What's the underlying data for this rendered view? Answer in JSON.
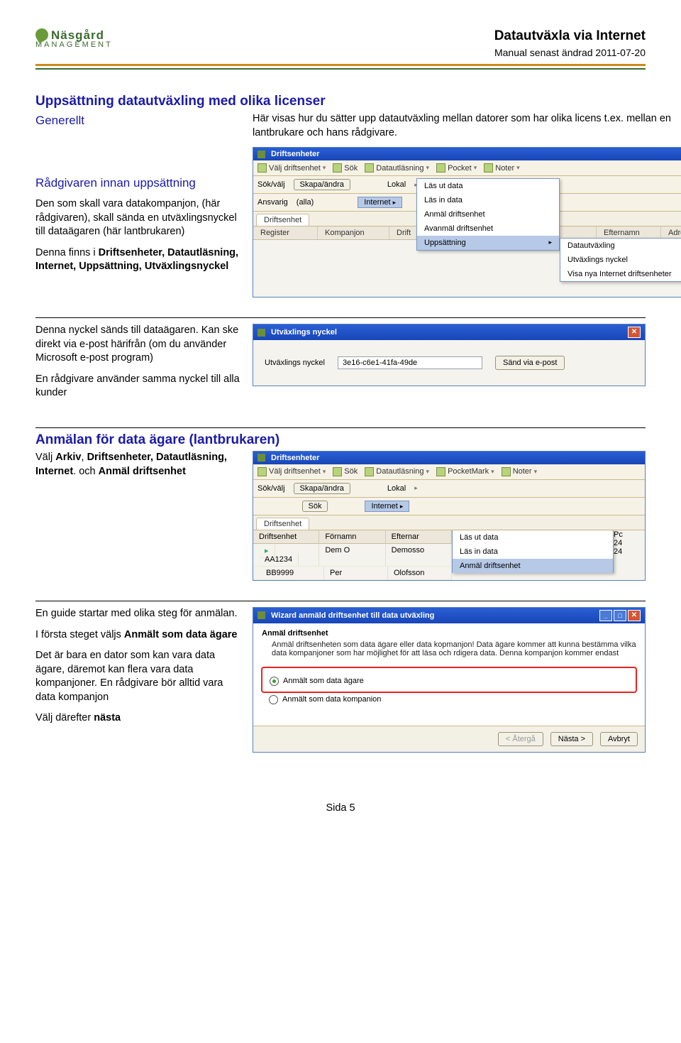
{
  "header": {
    "logo_top": "Näsgård",
    "logo_bottom": "MANAGEMENT",
    "title": "Datautväxla via Internet",
    "subtitle": "Manual senast ändrad 2011-07-20"
  },
  "section1": {
    "title": "Uppsättning datautväxling med olika licenser",
    "left_sub1": "Generellt",
    "right_p1": "Här visas hur du sätter upp datautväxling mellan datorer som har olika licens t.ex. mellan en lantbrukare och hans rådgivare.",
    "left_sub2": "Rådgivaren innan uppsättning",
    "left_p1": "Den som skall vara datakompanjon, (här rådgivaren), skall sända en utväxlingsnyckel till dataägaren (här lantbrukaren)",
    "left_p2a": "Denna finns i ",
    "left_p2b": "Driftsenheter, Datautläsning, Internet, Uppsättning, Utväxlingsnyckel"
  },
  "app1": {
    "title": "Driftsenheter",
    "toolbar": [
      "Välj driftsenhet",
      "Sök",
      "Datautläsning",
      "Pocket",
      "Noter"
    ],
    "sub_label1": "Sök/välj",
    "sub_btn1": "Skapa/ändra",
    "sub_sel1": "Lokal",
    "sub_label2": "Ansvarig",
    "sub_val2": "(alla)",
    "sub_sel2": "Internet",
    "tabs": [
      "Driftsenhet"
    ],
    "cols": [
      "Register",
      "Kompanjon",
      "Drift",
      "",
      "",
      "Efternamn",
      "Adress"
    ],
    "ctx": [
      "Läs ut data",
      "Läs in data",
      "Anmäl driftsenhet",
      "Avanmäl driftsenhet",
      "Uppsättning"
    ],
    "ctx_sel": 4,
    "sub": [
      "Datautväxling",
      "Utväxlings nyckel",
      "Visa nya Internet driftsenheter"
    ],
    "sub_sel": 1
  },
  "section2": {
    "left_p1": "Denna nyckel sänds till dataägaren. Kan ske direkt via e-post härifrån (om du använder Microsoft e-post program)",
    "left_p2": "En rådgivare använder samma nyckel till alla kunder"
  },
  "dlg": {
    "title": "Utväxlings nyckel",
    "label": "Utväxlings nyckel",
    "value": "3e16-c6e1-41fa-49de",
    "button": "Sänd via e-post"
  },
  "section3": {
    "title": "Anmälan för data ägare (lantbrukaren)",
    "left_p1a": "Välj ",
    "left_p1b": "Arkiv",
    "left_p1c": ", ",
    "left_p1d": "Driftsenheter, Datautläsning, Internet",
    "left_p1e": ". och ",
    "left_p1f": "Anmäl driftsenhet"
  },
  "app2": {
    "title": "Driftsenheter",
    "toolbar": [
      "Välj driftsenhet",
      "Sök",
      "Datautläsning",
      "PocketMark",
      "Noter"
    ],
    "sub_label1": "Sök/välj",
    "sub_btn1": "Skapa/ändra",
    "sub_sel1": "Lokal",
    "sub_label2": "",
    "sub_btn2": "Sök",
    "sub_sel2": "Internet",
    "tab": "Driftsenhet",
    "cols": [
      "Driftsenhet",
      "Förnamn",
      "Efternar"
    ],
    "rows": [
      [
        "AA1234",
        "Dem O",
        "Demosso"
      ],
      [
        "BB9999",
        "Per",
        "Olofsson"
      ]
    ],
    "ctx": [
      "Läs ut data",
      "Läs in data",
      "Anmäl driftsenhet"
    ],
    "ctx_sel": 2,
    "rcol": [
      "",
      "Pc",
      "24",
      "24"
    ]
  },
  "section4": {
    "left_p1": "En guide startar med olika steg för anmälan.",
    "left_p2a": "I första steget väljs ",
    "left_p2b": "Anmält som data ägare",
    "left_p3": "Det är bara en dator som kan vara data ägare, däremot kan flera vara data kompanjoner. En rådgivare bör alltid vara data kompanjon",
    "left_p4a": "Välj därefter ",
    "left_p4b": "nästa"
  },
  "wiz": {
    "title": "Wizard anmäld driftsenhet till data utväxling",
    "group_title": "Anmäl driftsenhet",
    "intro": "Anmäl driftsenheten som data ägare eller data kopmanjon! Data ägare kommer att kunna bestämma vilka data kompanjoner som har möjlighet för att läsa och rdigera data. Denna kompanjon kommer endast",
    "radio1": "Anmält som data ägare",
    "radio2": "Anmält som data kompanion",
    "btn_back": "< Återgå",
    "btn_next": "Nästa >",
    "btn_cancel": "Avbryt"
  },
  "footer": "Sida 5"
}
